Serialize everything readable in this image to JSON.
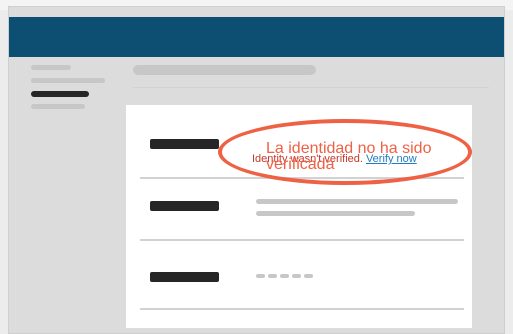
{
  "alert": {
    "message": "Identity wasn't verified.",
    "link": "Verify now"
  },
  "annotation": {
    "text": "La identidad no ha sido verificada"
  },
  "colors": {
    "header": "#0d4f73",
    "alert_text": "#c0392b",
    "link": "#1f7cc0",
    "annotation": "#ee6144"
  }
}
